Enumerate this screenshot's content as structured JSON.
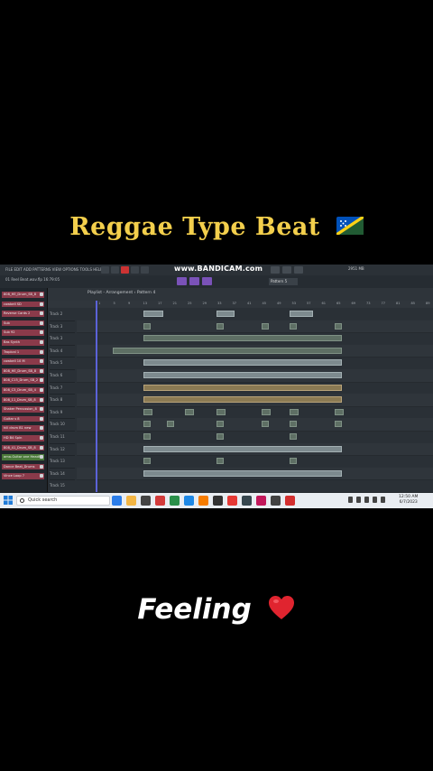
{
  "caption_top": "Reggae Type Beat",
  "caption_top_emoji": "solomon-islands-flag",
  "caption_bottom": "Feeling",
  "caption_bottom_emoji": "red-heart",
  "colors": {
    "title": "#f3cf4c",
    "caption": "#ffffff",
    "background": "#000000"
  },
  "screenshot": {
    "menu_text": "FILE EDIT ADD PATTERNS VIEW OPTIONS TOOLS HELP",
    "watermark": "www.BANDICAM.com",
    "song_info": "01 Reel Beat.wav.flp",
    "song_time": "16:79:05",
    "cpu": "2951 MB",
    "pattern_selector": "Pattern 5",
    "playlist_title": "Playlist - Arrangement › Pattern 4",
    "timeline_numbers": [
      "1",
      "5",
      "9",
      "13",
      "17",
      "21",
      "25",
      "29",
      "33",
      "37",
      "41",
      "45",
      "49",
      "53",
      "57",
      "61",
      "65",
      "69",
      "73",
      "77",
      "81",
      "85",
      "89",
      "93"
    ],
    "channels": [
      "808_HE_Drum_SB_8",
      "cowbell SD",
      "Reverse Cards 2",
      "Sub",
      "Sub 92",
      "Bas Synth",
      "Tropical 1",
      "cowbell 10 M",
      "808_HE_Drum_SB_8",
      "808_C15_Drum_SB_2",
      "808_C3_Drum_SB_4",
      "808_11_Drum_SB_8",
      "Shaker Percussion_8",
      "Guitar s 8",
      "hill drum B1 new",
      "HD B4 Spin",
      "808_41_Drum_SB_8",
      "ama-Guitar one HeadS",
      "Dance Beat_Drums",
      "Vince Loop 7"
    ],
    "tracks": [
      "Track 2",
      "Track 3",
      "Track 3",
      "Track 4",
      "Track 5",
      "Track 6",
      "Track 7",
      "Track 8",
      "Track 9",
      "Track 10",
      "Track 11",
      "Track 12",
      "Track 13",
      "Track 14",
      "Track 15"
    ],
    "taskbar": {
      "search_placeholder": "Quick search",
      "time": "12:50 AM",
      "date": "6/7/2023"
    }
  }
}
